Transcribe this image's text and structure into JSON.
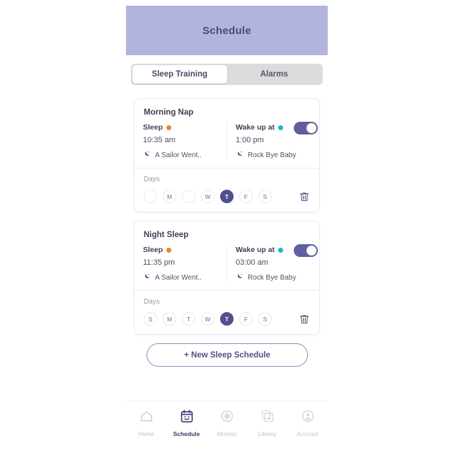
{
  "header": {
    "title": "Schedule"
  },
  "tabs": [
    {
      "label": "Sleep Training",
      "active": true
    },
    {
      "label": "Alarms",
      "active": false
    }
  ],
  "colors": {
    "header_bg": "#b2b4de",
    "accent": "#50508e",
    "sleep_dot": "#e8842c",
    "wake_dot": "#17b9c4",
    "tabbar_bg": "#dcdcdd"
  },
  "schedules": [
    {
      "title": "Morning Nap",
      "sleep_label": "Sleep",
      "sleep_time": "10:35 am",
      "sleep_sound": "A Sailor Went..",
      "wake_label": "Wake up at",
      "wake_time": "1:00 pm",
      "wake_sound": "Rock Bye Baby",
      "enabled": true,
      "days_label": "Days",
      "days": [
        {
          "letter": "",
          "on": false
        },
        {
          "letter": "M",
          "on": false
        },
        {
          "letter": "",
          "on": false
        },
        {
          "letter": "W",
          "on": false
        },
        {
          "letter": "T",
          "on": true
        },
        {
          "letter": "F",
          "on": false
        },
        {
          "letter": "S",
          "on": false
        }
      ]
    },
    {
      "title": "Night Sleep",
      "sleep_label": "Sleep",
      "sleep_time": "11:35 pm",
      "sleep_sound": "A Sailor Went..",
      "wake_label": "Wake up at",
      "wake_time": "03:00 am",
      "wake_sound": "Rock Bye Baby",
      "enabled": true,
      "days_label": "Days",
      "days": [
        {
          "letter": "S",
          "on": false
        },
        {
          "letter": "M",
          "on": false
        },
        {
          "letter": "T",
          "on": false
        },
        {
          "letter": "W",
          "on": false
        },
        {
          "letter": "T",
          "on": true
        },
        {
          "letter": "F",
          "on": false
        },
        {
          "letter": "S",
          "on": false
        }
      ]
    }
  ],
  "new_schedule_button": {
    "label": "+ New Sleep Schedule"
  },
  "bottom_nav": [
    {
      "label": "Home",
      "icon": "home-icon",
      "active": false
    },
    {
      "label": "Schedule",
      "icon": "calendar-smile-icon",
      "active": true
    },
    {
      "label": "Monitor",
      "icon": "sound-wave-icon",
      "active": false
    },
    {
      "label": "Library",
      "icon": "music-library-icon",
      "active": false
    },
    {
      "label": "Account",
      "icon": "account-icon",
      "active": false
    }
  ]
}
